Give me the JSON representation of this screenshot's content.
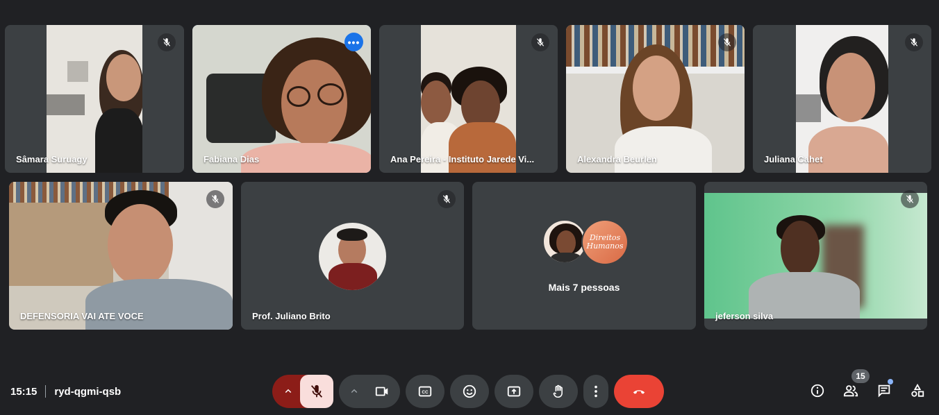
{
  "participants": [
    {
      "name": "Sâmara Suruagy",
      "muted": true
    },
    {
      "name": "Fabiana Dias",
      "muted": false,
      "active_speaker": true
    },
    {
      "name": "Ana Pereira - Instituto Jarede Vi...",
      "muted": true
    },
    {
      "name": "Alexandra Beurlen",
      "muted": true
    },
    {
      "name": "Juliana Cahet",
      "muted": true
    },
    {
      "name": "DEFENSORIA VAI ATE VOCE",
      "muted": true
    },
    {
      "name": "Prof. Juliano Brito",
      "muted": true
    },
    {
      "name": "jeferson silva",
      "muted": true
    }
  ],
  "overflow_tile": {
    "label": "Mais 7 pessoas",
    "avatar_text": "Direitos Humanos"
  },
  "more_options_label": "•••",
  "meeting": {
    "time": "15:15",
    "code": "ryd-qgmi-qsb"
  },
  "controls": [
    {
      "name": "mic-options",
      "icon": "chevron-up-icon"
    },
    {
      "name": "microphone",
      "icon": "mic-off-icon",
      "state": "off"
    },
    {
      "name": "camera-options",
      "icon": "chevron-up-icon"
    },
    {
      "name": "camera",
      "icon": "videocam-icon"
    },
    {
      "name": "captions",
      "icon": "closed-caption-icon"
    },
    {
      "name": "reactions",
      "icon": "emoji-icon"
    },
    {
      "name": "present",
      "icon": "present-screen-icon"
    },
    {
      "name": "raise-hand",
      "icon": "hand-icon"
    },
    {
      "name": "more-options",
      "icon": "more-vert-icon"
    },
    {
      "name": "leave-call",
      "icon": "call-end-icon"
    }
  ],
  "right_controls": {
    "info_icon": "info-icon",
    "people_icon": "people-icon",
    "people_count": "15",
    "chat_icon": "chat-icon",
    "activities_icon": "activities-icon"
  },
  "colors": {
    "background": "#202124",
    "tile": "#3c4043",
    "leave": "#ea4335",
    "mic_off_bg": "#f9dedc",
    "active_border": "#8ab4f8"
  }
}
